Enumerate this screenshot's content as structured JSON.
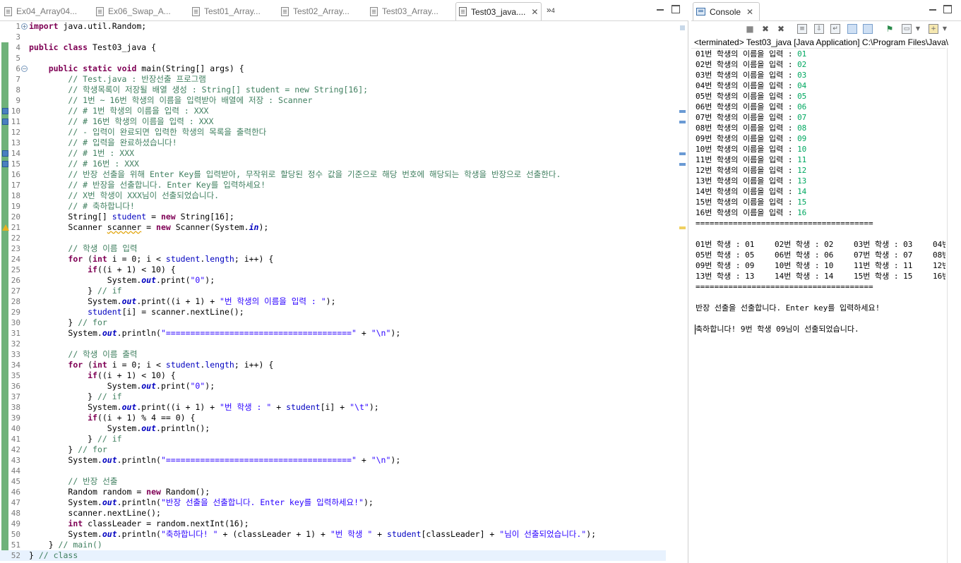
{
  "editor": {
    "tabs": [
      {
        "label": "Ex04_Array04...",
        "active": false
      },
      {
        "label": "Ex06_Swap_A...",
        "active": false
      },
      {
        "label": "Test01_Array...",
        "active": false
      },
      {
        "label": "Test02_Array...",
        "active": false
      },
      {
        "label": "Test03_Array...",
        "active": false
      },
      {
        "label": "Test03_java....",
        "active": true
      }
    ],
    "overflow_label": "»",
    "overflow_count": "4",
    "close_glyph": "✕",
    "lines": [
      {
        "n": "1",
        "text": "import java.util.Random;"
      },
      {
        "n": "3",
        "text": ""
      },
      {
        "n": "4",
        "text": "public class Test03_java {"
      },
      {
        "n": "5",
        "text": ""
      },
      {
        "n": "6",
        "text": "    public static void main(String[] args) {"
      },
      {
        "n": "7",
        "text": "        // Test.java : 반장선출 프로그램"
      },
      {
        "n": "8",
        "text": "        // 학생목록이 저장될 배열 생성 : String[] student = new String[16];"
      },
      {
        "n": "9",
        "text": "        // 1번 ~ 16번 학생의 이름을 입력받아 배열에 저장 : Scanner"
      },
      {
        "n": "10",
        "text": "        // # 1번 학생의 이름을 입력 : XXX"
      },
      {
        "n": "11",
        "text": "        // # 16번 학생의 이름을 입력 : XXX"
      },
      {
        "n": "12",
        "text": "        // - 입력이 완료되면 입력한 학생의 목록을 출력한다"
      },
      {
        "n": "13",
        "text": "        // # 입력을 완료하셨습니다!"
      },
      {
        "n": "14",
        "text": "        // # 1번 : XXX"
      },
      {
        "n": "15",
        "text": "        // # 16번 : XXX"
      },
      {
        "n": "16",
        "text": "        // 반장 선출을 위해 Enter Key를 입력받아, 무작위로 할당된 정수 값을 기준으로 해당 번호에 해당되는 학생을 반장으로 선출한다."
      },
      {
        "n": "17",
        "text": "        // # 반장을 선출합니다. Enter Key를 입력하세요!"
      },
      {
        "n": "18",
        "text": "        // X번 학생이 XXX님이 선출되었습니다."
      },
      {
        "n": "19",
        "text": "        // # 축하합니다!"
      },
      {
        "n": "20",
        "text": "        String[] student = new String[16];"
      },
      {
        "n": "21",
        "text": "        Scanner scanner = new Scanner(System.in);"
      },
      {
        "n": "22",
        "text": ""
      },
      {
        "n": "23",
        "text": "        // 학생 이름 입력"
      },
      {
        "n": "24",
        "text": "        for (int i = 0; i < student.length; i++) {"
      },
      {
        "n": "25",
        "text": "            if((i + 1) < 10) {"
      },
      {
        "n": "26",
        "text": "                System.out.print(\"0\");"
      },
      {
        "n": "27",
        "text": "            } // if"
      },
      {
        "n": "28",
        "text": "            System.out.print((i + 1) + \"번 학생의 이름을 입력 : \");"
      },
      {
        "n": "29",
        "text": "            student[i] = scanner.nextLine();"
      },
      {
        "n": "30",
        "text": "        } // for"
      },
      {
        "n": "31",
        "text": "        System.out.println(\"======================================\" + \"\\n\");"
      },
      {
        "n": "32",
        "text": ""
      },
      {
        "n": "33",
        "text": "        // 학생 이름 출력"
      },
      {
        "n": "34",
        "text": "        for (int i = 0; i < student.length; i++) {"
      },
      {
        "n": "35",
        "text": "            if((i + 1) < 10) {"
      },
      {
        "n": "36",
        "text": "                System.out.print(\"0\");"
      },
      {
        "n": "37",
        "text": "            } // if"
      },
      {
        "n": "38",
        "text": "            System.out.print((i + 1) + \"번 학생 : \" + student[i] + \"\\t\");"
      },
      {
        "n": "39",
        "text": "            if((i + 1) % 4 == 0) {"
      },
      {
        "n": "40",
        "text": "                System.out.println();"
      },
      {
        "n": "41",
        "text": "            } // if"
      },
      {
        "n": "42",
        "text": "        } // for"
      },
      {
        "n": "43",
        "text": "        System.out.println(\"======================================\" + \"\\n\");"
      },
      {
        "n": "44",
        "text": ""
      },
      {
        "n": "45",
        "text": "        // 반장 선출"
      },
      {
        "n": "46",
        "text": "        Random random = new Random();"
      },
      {
        "n": "47",
        "text": "        System.out.println(\"반장 선출을 선출합니다. Enter key를 입력하세요!\");"
      },
      {
        "n": "48",
        "text": "        scanner.nextLine();"
      },
      {
        "n": "49",
        "text": "        int classLeader = random.nextInt(16);"
      },
      {
        "n": "50",
        "text": "        System.out.println(\"축하합니다! \" + (classLeader + 1) + \"번 학생 \" + student[classLeader] + \"님이 선출되었습니다.\");"
      },
      {
        "n": "51",
        "text": "    } // main()"
      },
      {
        "n": "52",
        "text": "} // class"
      }
    ]
  },
  "console": {
    "tab_label": "Console",
    "close_glyph": "✕",
    "header": "<terminated> Test03_java [Java Application] C:\\Program Files\\Java\\",
    "prompts": [
      {
        "prompt": "01번 학생의 이름을 입력 : ",
        "input": "01"
      },
      {
        "prompt": "02번 학생의 이름을 입력 : ",
        "input": "02"
      },
      {
        "prompt": "03번 학생의 이름을 입력 : ",
        "input": "03"
      },
      {
        "prompt": "04번 학생의 이름을 입력 : ",
        "input": "04"
      },
      {
        "prompt": "05번 학생의 이름을 입력 : ",
        "input": "05"
      },
      {
        "prompt": "06번 학생의 이름을 입력 : ",
        "input": "06"
      },
      {
        "prompt": "07번 학생의 이름을 입력 : ",
        "input": "07"
      },
      {
        "prompt": "08번 학생의 이름을 입력 : ",
        "input": "08"
      },
      {
        "prompt": "09번 학생의 이름을 입력 : ",
        "input": "09"
      },
      {
        "prompt": "10번 학생의 이름을 입력 : ",
        "input": "10"
      },
      {
        "prompt": "11번 학생의 이름을 입력 : ",
        "input": "11"
      },
      {
        "prompt": "12번 학생의 이름을 입력 : ",
        "input": "12"
      },
      {
        "prompt": "13번 학생의 이름을 입력 : ",
        "input": "13"
      },
      {
        "prompt": "14번 학생의 이름을 입력 : ",
        "input": "14"
      },
      {
        "prompt": "15번 학생의 이름을 입력 : ",
        "input": "15"
      },
      {
        "prompt": "16번 학생의 이름을 입력 : ",
        "input": "16"
      }
    ],
    "separator": "======================================",
    "grid": [
      [
        "01번 학생 : 01",
        "02번 학생 : 02",
        "03번 학생 : 03",
        "04번"
      ],
      [
        "05번 학생 : 05",
        "06번 학생 : 06",
        "07번 학생 : 07",
        "08번"
      ],
      [
        "09번 학생 : 09",
        "10번 학생 : 10",
        "11번 학생 : 11",
        "12번"
      ],
      [
        "13번 학생 : 13",
        "14번 학생 : 14",
        "15번 학생 : 15",
        "16번"
      ]
    ],
    "announce": "반장 선출을 선출합니다. Enter key를 입력하세요!",
    "result": "축하합니다! 9번 학생 09님이 선출되었습니다."
  }
}
